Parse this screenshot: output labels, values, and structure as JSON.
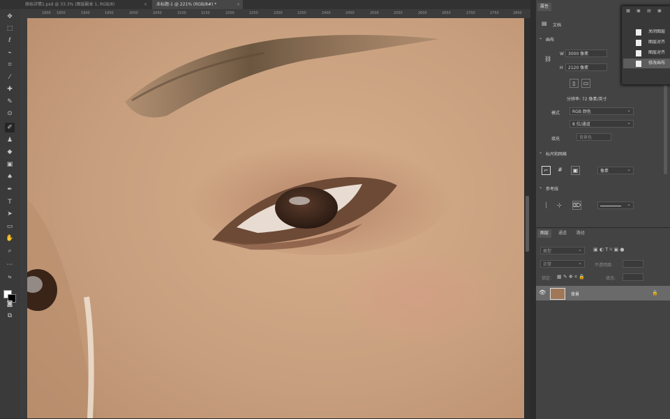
{
  "tabs": [
    {
      "label": "原始详情1.psd @ 33.3% (图层副本 1, RGB/8)",
      "close": "×"
    },
    {
      "label": "未标题-1 @ 221% (RGB/8#) *",
      "close": "×"
    }
  ],
  "ruler_ticks": [
    "1800",
    "1850",
    "1900",
    "1950",
    "2000",
    "2050",
    "2100",
    "2150",
    "2200",
    "2250",
    "2300",
    "2350",
    "2400",
    "2450",
    "2500",
    "2550",
    "2600",
    "2650",
    "2700",
    "2750",
    "2800"
  ],
  "properties": {
    "tab_label": "属性",
    "doc_label": "文档",
    "canvas_section": "画布",
    "w_label": "W",
    "w_value": "3000 像素",
    "h_label": "H",
    "h_value": "2120 像素",
    "resolution": "分辨率: 72 像素/英寸",
    "mode_label": "模式",
    "mode_value": "RGB 颜色",
    "bits_value": "8 位/通道",
    "fill_label": "填充",
    "fill_value": "背景色",
    "rulers_section": "标尺和网格",
    "units_value": "像素",
    "guides_section": "参考线"
  },
  "history": {
    "items": [
      "关闭图层",
      "图层对齐",
      "图层对齐",
      "修改画布"
    ]
  },
  "layers": {
    "tabs": [
      "图层",
      "通道",
      "路径"
    ],
    "search_placeholder": "类型",
    "blend_mode": "正常",
    "opacity_label": "不透明度:",
    "lock_label": "锁定:",
    "fill_label": "填充:",
    "layer_name": "背景"
  },
  "colors": {
    "accent": "#0f7af2",
    "skin": "#c89e7d"
  }
}
